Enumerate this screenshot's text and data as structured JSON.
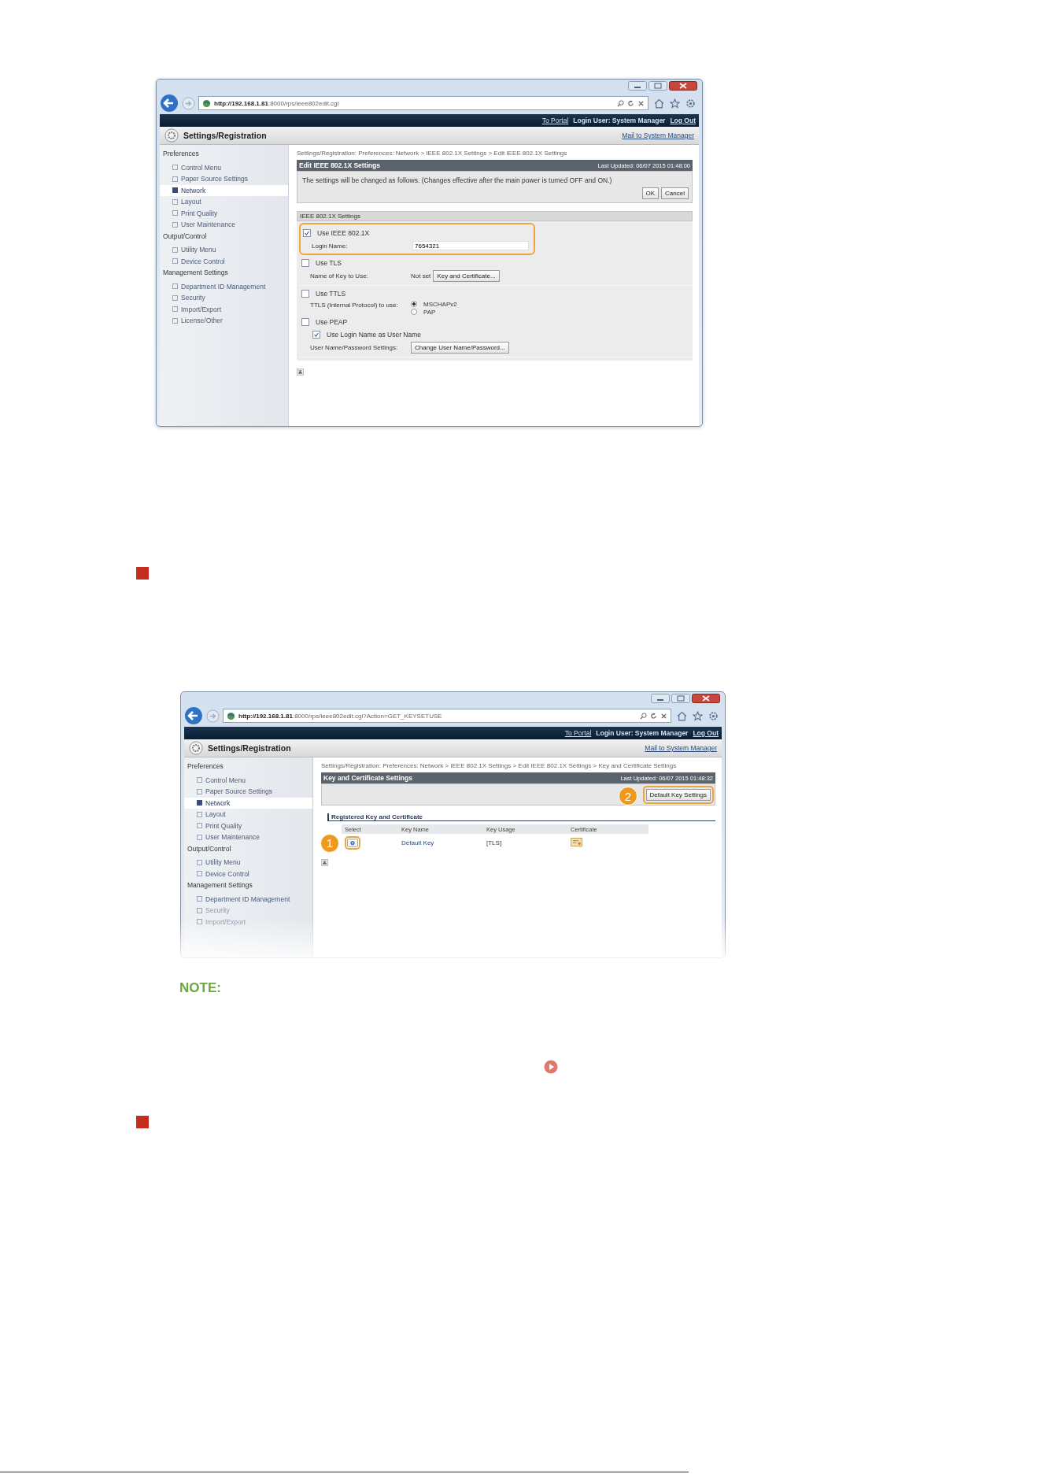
{
  "screenshots": [
    {
      "url_host": "http://192.168.1.81",
      "url_path": ":8000/rps/ieee802edit.cgi",
      "header_links": [
        "To Portal",
        "Login User: System Manager",
        "Log Out"
      ],
      "app_title": "Settings/Registration",
      "mail_link": "Mail to System Manager",
      "sidebar": [
        {
          "heading": "Preferences",
          "items": [
            {
              "label": "Control Menu",
              "selected": false,
              "faded": false
            },
            {
              "label": "Paper Source Settings",
              "selected": false,
              "faded": false
            },
            {
              "label": "Network",
              "selected": true,
              "faded": false
            },
            {
              "label": "Layout",
              "selected": false,
              "faded": false
            },
            {
              "label": "Print Quality",
              "selected": false,
              "faded": false
            },
            {
              "label": "User Maintenance",
              "selected": false,
              "faded": false
            }
          ]
        },
        {
          "heading": "Output/Control",
          "items": [
            {
              "label": "Utility Menu",
              "selected": false,
              "faded": false
            },
            {
              "label": "Device Control",
              "selected": false,
              "faded": false
            }
          ]
        },
        {
          "heading": "Management Settings",
          "items": [
            {
              "label": "Department ID Management",
              "selected": false,
              "faded": false
            },
            {
              "label": "Security",
              "selected": false,
              "faded": false
            },
            {
              "label": "Import/Export",
              "selected": false,
              "faded": false
            },
            {
              "label": "License/Other",
              "selected": false,
              "faded": false
            }
          ]
        }
      ],
      "breadcrumb": "Settings/Registration: Preferences: Network > IEEE 802.1X Settings > Edit IEEE 802.1X Settings",
      "panel": {
        "kind": "form",
        "title": "Edit IEEE 802.1X Settings",
        "updated": "Last Updated: 06/07 2015 01:48:00",
        "message": "The settings will be changed as follows. (Changes effective after the main power is turned OFF and ON.)",
        "buttons": [
          "OK",
          "Cancel"
        ],
        "section_title": "IEEE 802.1X Settings",
        "groups": [
          {
            "highlighted": true,
            "rows": [
              {
                "kind": "checkbox",
                "label": "Use IEEE 802.1X",
                "checked": true
              },
              {
                "kind": "field",
                "label": "Login Name:",
                "value": "7654321"
              }
            ]
          },
          {
            "highlighted": false,
            "rows": [
              {
                "kind": "checkbox",
                "label": "Use TLS",
                "checked": false
              },
              {
                "kind": "button",
                "label": "Name of Key to Use:",
                "note": "Not set",
                "button": "Key and Certificate..."
              }
            ]
          },
          {
            "highlighted": false,
            "rows": [
              {
                "kind": "checkbox",
                "label": "Use TTLS",
                "checked": false
              },
              {
                "kind": "radio",
                "label": "TTLS (Internal Protocol) to use:",
                "options": [
                  {
                    "label": "MSCHAPv2",
                    "selected": true
                  },
                  {
                    "label": "PAP",
                    "selected": false
                  }
                ]
              },
              {
                "kind": "checkbox",
                "label": "Use PEAP",
                "checked": false,
                "children": [
                  {
                    "label": "Use Login Name as User Name",
                    "checked": true
                  }
                ]
              },
              {
                "kind": "button",
                "label": "User Name/Password Settings:",
                "button": "Change User Name/Password..."
              }
            ]
          }
        ]
      }
    },
    {
      "url_host": "http://192.168.1.81",
      "url_path": ":8000/rps/ieee802edit.cgi?Action=GET_KEYSETUSE",
      "header_links": [
        "To Portal",
        "Login User: System Manager",
        "Log Out"
      ],
      "app_title": "Settings/Registration",
      "mail_link": "Mail to System Manager",
      "sidebar": [
        {
          "heading": "Preferences",
          "items": [
            {
              "label": "Control Menu",
              "selected": false,
              "faded": false
            },
            {
              "label": "Paper Source Settings",
              "selected": false,
              "faded": false
            },
            {
              "label": "Network",
              "selected": true,
              "faded": false
            },
            {
              "label": "Layout",
              "selected": false,
              "faded": false
            },
            {
              "label": "Print Quality",
              "selected": false,
              "faded": false
            },
            {
              "label": "User Maintenance",
              "selected": false,
              "faded": false
            }
          ]
        },
        {
          "heading": "Output/Control",
          "items": [
            {
              "label": "Utility Menu",
              "selected": false,
              "faded": false
            },
            {
              "label": "Device Control",
              "selected": false,
              "faded": false
            }
          ]
        },
        {
          "heading": "Management Settings",
          "items": [
            {
              "label": "Department ID Management",
              "selected": false,
              "faded": false
            },
            {
              "label": "Security",
              "selected": false,
              "faded": true
            },
            {
              "label": "Import/Export",
              "selected": false,
              "faded": true
            }
          ]
        }
      ],
      "breadcrumb": "Settings/Registration: Preferences: Network > IEEE 802.1X Settings > Edit IEEE 802.1X Settings > Key and Certificate Settings",
      "panel": {
        "kind": "keys",
        "title": "Key and Certificate Settings",
        "updated": "Last Updated: 06/07 2015 01:48:32",
        "action_button": "Default Key Settings",
        "action_callout": "2",
        "section_title": "Registered Key and Certificate",
        "columns": [
          "Select",
          "Key Name",
          "Key Usage",
          "Certificate"
        ],
        "rows": [
          {
            "select_callout": "1",
            "key_name": "Default Key",
            "key_usage": "[TLS]"
          }
        ]
      }
    }
  ],
  "note_heading": "NOTE:"
}
